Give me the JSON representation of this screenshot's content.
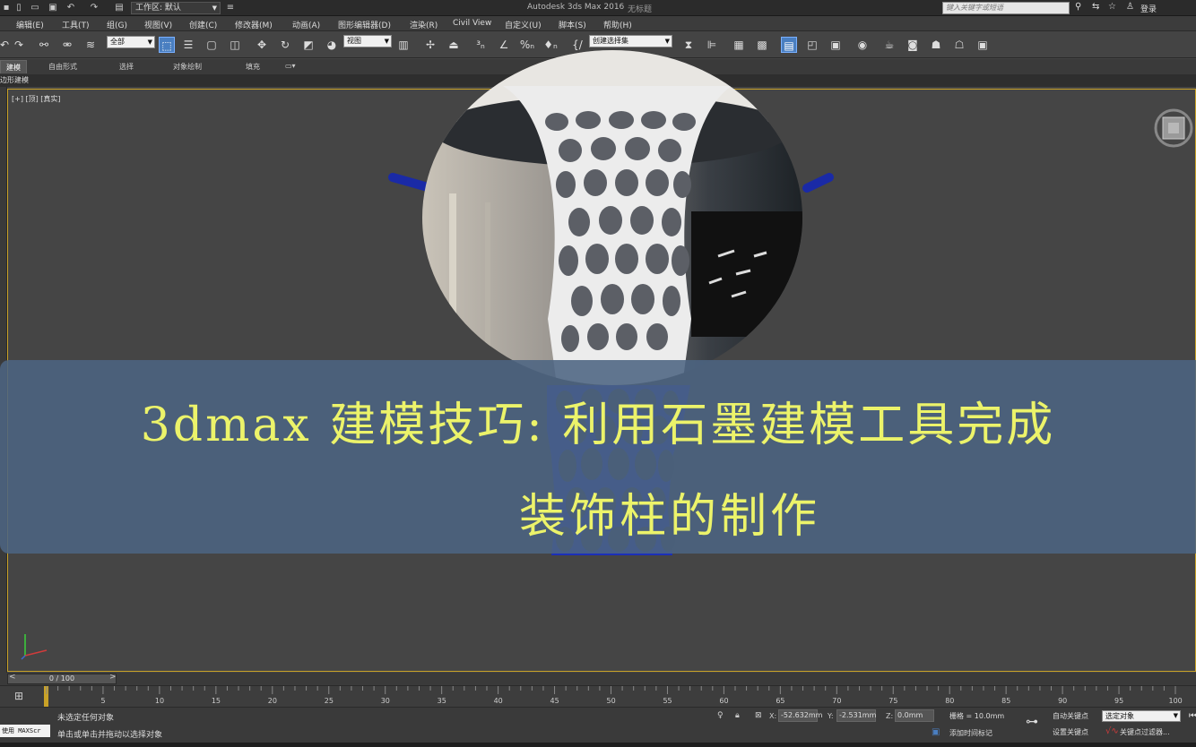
{
  "titlebar": {
    "workspace_label": "工作区: 默认",
    "app_title": "Autodesk 3ds Max 2016",
    "doc_title": "无标题",
    "search_placeholder": "键入关键字或短语",
    "login": "登录"
  },
  "menu": [
    "编辑(E)",
    "工具(T)",
    "组(G)",
    "视图(V)",
    "创建(C)",
    "修改器(M)",
    "动画(A)",
    "图形编辑器(D)",
    "渲染(R)",
    "Civil View",
    "自定义(U)",
    "脚本(S)",
    "帮助(H)"
  ],
  "toolbar": {
    "selection_filter": "全部",
    "ref_coord": "视图",
    "named_selection": "创建选择集"
  },
  "ribbon": {
    "tabs": [
      "建模",
      "自由形式",
      "选择",
      "对象绘制",
      "填充"
    ],
    "active": "建模",
    "panel_label": "边形建模"
  },
  "viewport": {
    "label": "[+] [顶] [真实]"
  },
  "banner": {
    "line1": "3dmax 建模技巧: 利用石墨建模工具完成",
    "line2": "装饰柱的制作"
  },
  "timeslider": {
    "value": "0 / 100"
  },
  "ruler": {
    "labels": [
      "5",
      "10",
      "15",
      "20",
      "25",
      "30",
      "35",
      "40",
      "45",
      "50",
      "55",
      "60",
      "65",
      "70",
      "75",
      "80",
      "85",
      "90",
      "95",
      "100"
    ]
  },
  "statusbar": {
    "maxscript_label": "使用 MAXScr",
    "status_line1": "未选定任何对象",
    "status_line2": "单击或单击并拖动以选择对象",
    "x_label": "X:",
    "x_value": "-52.632mm",
    "y_label": "Y:",
    "y_value": "-2.531mm",
    "z_label": "Z:",
    "z_value": "0.0mm",
    "grid": "栅格 = 10.0mm",
    "add_time_tag": "添加时间标记",
    "auto_key": "自动关键点",
    "set_key": "设置关键点",
    "key_mode": "选定对象",
    "key_filters": "关键点过滤器..."
  }
}
